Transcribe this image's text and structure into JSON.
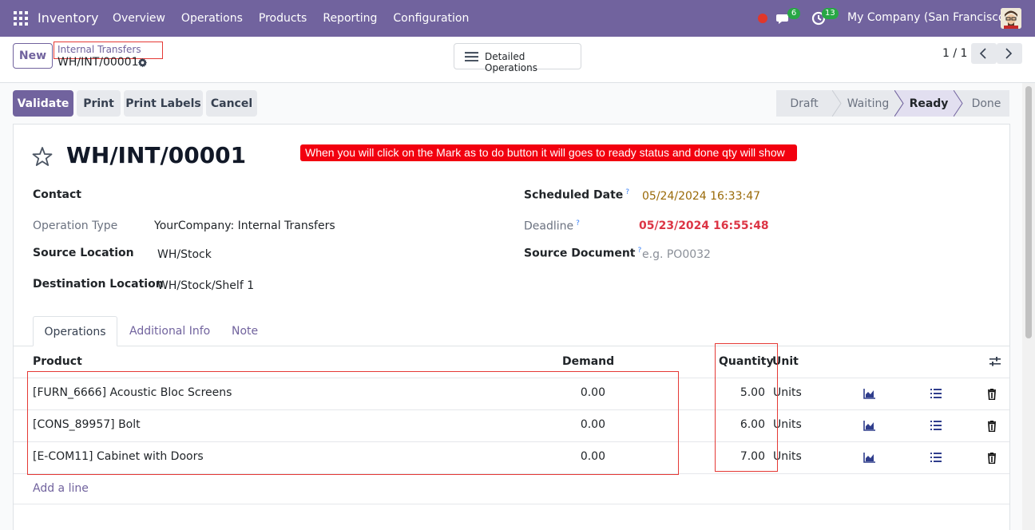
{
  "navbar": {
    "app_name": "Inventory",
    "menu": [
      "Overview",
      "Operations",
      "Products",
      "Reporting",
      "Configuration"
    ],
    "messages_count": "6",
    "activities_count": "13",
    "company": "My Company (San Francisco)"
  },
  "control_panel": {
    "new_label": "New",
    "breadcrumb_parent": "Internal Transfers",
    "breadcrumb_current": "WH/INT/00001",
    "detailed_ops_label": "Detailed Operations",
    "pager": "1 / 1"
  },
  "actions": {
    "validate": "Validate",
    "print": "Print",
    "print_labels": "Print Labels",
    "cancel": "Cancel"
  },
  "status_stages": [
    "Draft",
    "Waiting",
    "Ready",
    "Done"
  ],
  "status_active": "Ready",
  "record": {
    "title": "WH/INT/00001",
    "annotation": "When you will click on the Mark as to do button it will goes to ready status and done qty will show",
    "fields": {
      "contact_label": "Contact",
      "operation_type_label": "Operation Type",
      "operation_type_value": "YourCompany: Internal Transfers",
      "source_location_label": "Source Location",
      "source_location_value": "WH/Stock",
      "destination_location_label": "Destination Location",
      "destination_location_value": "WH/Stock/Shelf 1",
      "scheduled_date_label": "Scheduled Date",
      "scheduled_date_value": "05/24/2024 16:33:47",
      "deadline_label": "Deadline",
      "deadline_value": "05/23/2024 16:55:48",
      "source_document_label": "Source Document",
      "source_document_placeholder": "e.g. PO0032",
      "help_mark": "?"
    }
  },
  "tabs": [
    "Operations",
    "Additional Info",
    "Note"
  ],
  "table": {
    "headers": {
      "product": "Product",
      "demand": "Demand",
      "quantity": "Quantity",
      "unit": "Unit"
    },
    "rows": [
      {
        "product": "[FURN_6666] Acoustic Bloc Screens",
        "demand": "0.00",
        "quantity": "5.00",
        "unit": "Units"
      },
      {
        "product": "[CONS_89957] Bolt",
        "demand": "0.00",
        "quantity": "6.00",
        "unit": "Units"
      },
      {
        "product": "[E-COM11] Cabinet with Doors",
        "demand": "0.00",
        "quantity": "7.00",
        "unit": "Units"
      }
    ],
    "add_line": "Add a line"
  },
  "colors": {
    "brand": "#71639e",
    "annotation_red": "#f2000f",
    "deadline": "#dc3545",
    "badge": "#28a745"
  },
  "icons": [
    "apps-grid-icon",
    "record-dot-icon",
    "chat-icon",
    "clock-icon",
    "gear-icon",
    "list-icon",
    "chevron-left-icon",
    "chevron-right-icon",
    "star-icon",
    "sliders-icon",
    "area-chart-icon",
    "bullet-list-icon",
    "trash-icon"
  ]
}
